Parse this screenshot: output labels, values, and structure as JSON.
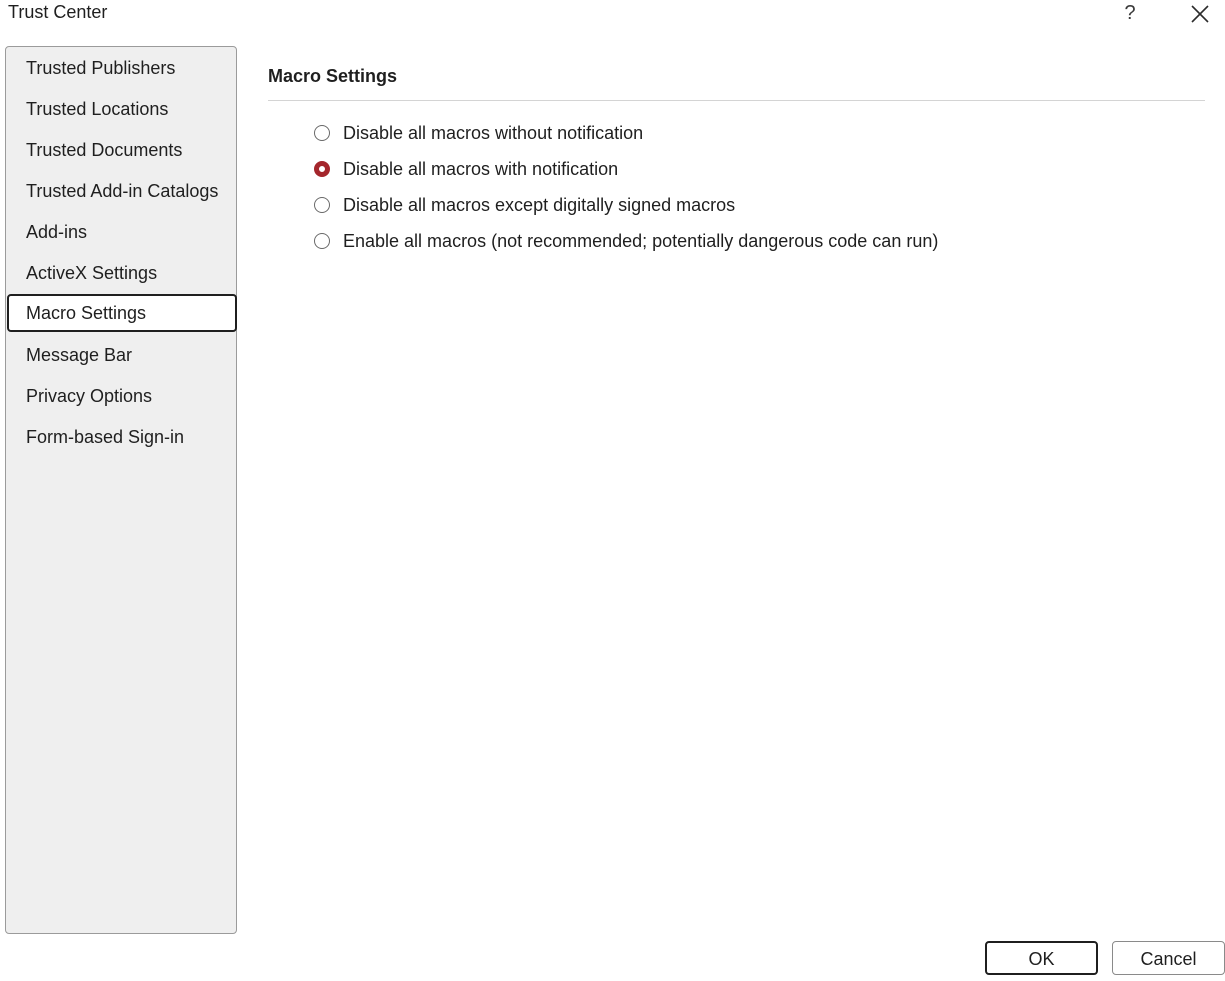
{
  "window": {
    "title": "Trust Center",
    "help_glyph": "?",
    "help_icon": "question-mark-icon",
    "close_icon": "close-x-icon"
  },
  "sidebar": {
    "selected_index": 6,
    "items": [
      {
        "label": "Trusted Publishers"
      },
      {
        "label": "Trusted Locations"
      },
      {
        "label": "Trusted Documents"
      },
      {
        "label": "Trusted Add-in Catalogs"
      },
      {
        "label": "Add-ins"
      },
      {
        "label": "ActiveX Settings"
      },
      {
        "label": "Macro Settings"
      },
      {
        "label": "Message Bar"
      },
      {
        "label": "Privacy Options"
      },
      {
        "label": "Form-based Sign-in"
      }
    ]
  },
  "main": {
    "section_title": "Macro Settings",
    "selected_option": 1,
    "options": [
      {
        "label": "Disable all macros without notification",
        "checked": false
      },
      {
        "label": "Disable all macros with notification",
        "checked": true
      },
      {
        "label": "Disable all macros except digitally signed macros",
        "checked": false
      },
      {
        "label": "Enable all macros (not recommended; potentially dangerous code can run)",
        "checked": false
      }
    ]
  },
  "footer": {
    "ok_label": "OK",
    "cancel_label": "Cancel"
  },
  "colors": {
    "accent_radio": "#a4262c",
    "sidebar_bg": "#efefef",
    "text": "#1f1f1f"
  }
}
